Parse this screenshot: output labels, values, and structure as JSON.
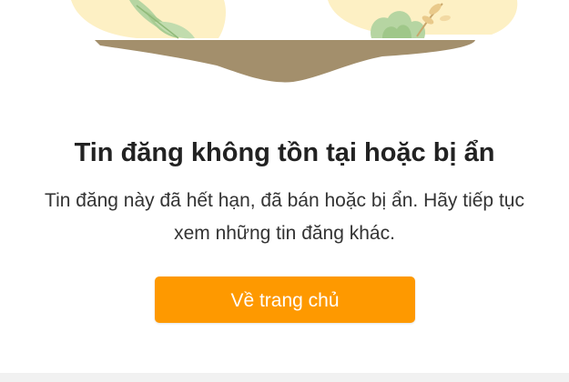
{
  "notice": {
    "title": "Tin đăng không tồn tại hoặc bị ẩn",
    "message": "Tin đăng này đã hết hạn, đã bán hoặc bị ẩn. Hãy tiếp tục xem những tin đăng khác.",
    "home_button_label": "Về trang chủ"
  },
  "illustration": {
    "icon": "empty-listing-illustration-icon"
  },
  "colors": {
    "accent": "#fe9900",
    "title_text": "#222222",
    "body_text": "#333333",
    "ground": "#a38f6c",
    "plant_green": "#b6d5a2",
    "sky_glow": "#fdf0c4",
    "bottom_strip": "#f1f1f1"
  }
}
